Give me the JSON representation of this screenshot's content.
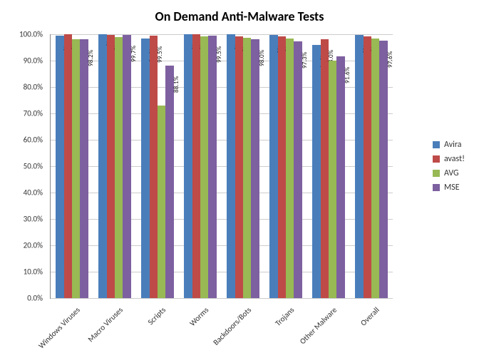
{
  "chart_data": {
    "type": "bar",
    "title": "On Demand Anti-Malware Tests",
    "xlabel": "",
    "ylabel": "",
    "ylim": [
      0,
      100
    ],
    "y_tick_step": 10,
    "y_tick_format": "{v}.0%",
    "categories": [
      "Windows Viruses",
      "Macro Viruses",
      "Scripts",
      "Worms",
      "Backdoors/Bots",
      "Trojans",
      "Other Malware",
      "Overall"
    ],
    "series": [
      {
        "name": "Avira",
        "color": "#4A7EBB",
        "values": [
          99.4,
          100.0,
          98.5,
          99.9,
          99.9,
          99.8,
          96.0,
          99.8
        ],
        "labels": [
          "99.4%",
          "100.0%",
          "98.5%",
          "99.9%",
          "99.9%",
          "99.8%",
          "96.0%",
          "99.8%"
        ]
      },
      {
        "name": "avast!",
        "color": "#BE4B48",
        "values": [
          99.9,
          99.7,
          99.5,
          99.9,
          99.2,
          99.2,
          98.0,
          99.3
        ],
        "labels": [
          "99.9%",
          "99.7%",
          "99.5%",
          "99.9%",
          "99.2%",
          "99.2%",
          "98.0%",
          "99.3%"
        ]
      },
      {
        "name": "AVG",
        "color": "#98B954",
        "values": [
          98.1,
          98.8,
          73.1,
          99.3,
          98.6,
          98.4,
          90.0,
          98.3
        ],
        "labels": [
          "98.1%",
          "98.8%",
          "73.1%",
          "99.3%",
          "98.6%",
          "98.4%",
          "90.0%",
          "98.3%"
        ]
      },
      {
        "name": "MSE",
        "color": "#7D60A0",
        "values": [
          98.2,
          99.7,
          88.1,
          99.5,
          98.0,
          97.3,
          91.6,
          97.6
        ],
        "labels": [
          "98.2%",
          "99.7%",
          "88.1%",
          "99.5%",
          "98.0%",
          "97.3%",
          "91.6%",
          "97.6%"
        ]
      }
    ]
  }
}
